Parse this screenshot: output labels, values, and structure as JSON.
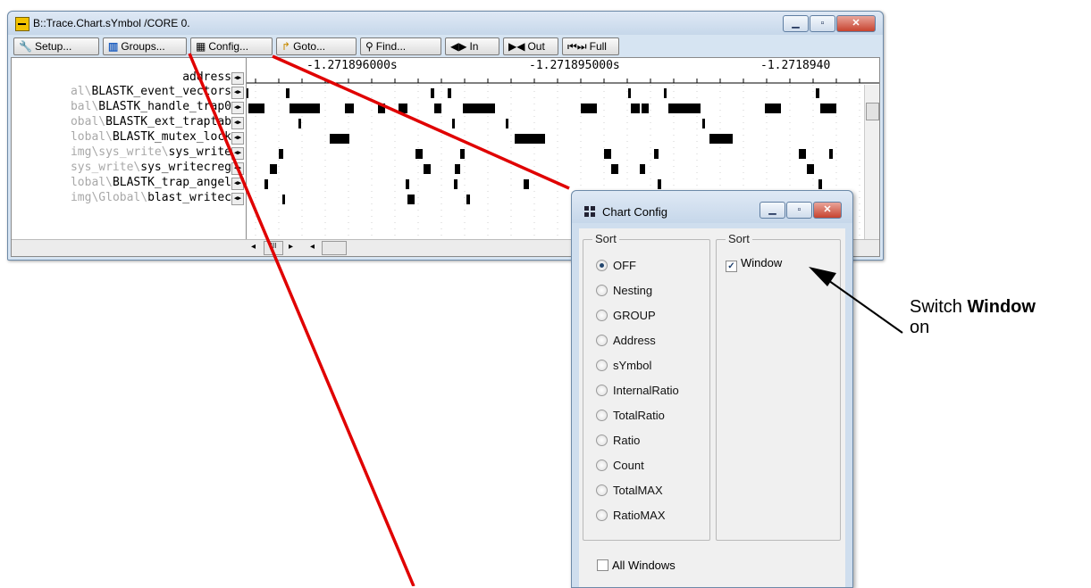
{
  "trace_window": {
    "title": "B::Trace.Chart.sYmbol /CORE 0.",
    "toolbar": {
      "setup": "Setup...",
      "groups": "Groups...",
      "config": "Config...",
      "goto": "Goto...",
      "find": "Find...",
      "in": "In",
      "out": "Out",
      "full": "Full"
    },
    "address_header": "address",
    "time_labels": [
      "-1.271896000s",
      "-1.271895000s",
      "-1.2718940"
    ],
    "rows": [
      {
        "prefix": "al\\",
        "name": "BLASTK_event_vectors"
      },
      {
        "prefix": "bal\\",
        "name": "BLASTK_handle_trap0"
      },
      {
        "prefix": "obal\\",
        "name": "BLASTK_ext_traptab"
      },
      {
        "prefix": "lobal\\",
        "name": "BLASTK_mutex_lock"
      },
      {
        "prefix": "img\\sys_write\\",
        "name": "sys_write"
      },
      {
        "prefix": "sys_write\\",
        "name": "sys_writecreg"
      },
      {
        "prefix": "lobal\\",
        "name": "BLASTK_trap_angel"
      },
      {
        "prefix": "img\\Global\\",
        "name": "blast_writec"
      }
    ]
  },
  "config_dialog": {
    "title": "Chart Config",
    "sort_group_title": "Sort",
    "sort_options": [
      "OFF",
      "Nesting",
      "GROUP",
      "Address",
      "sYmbol",
      "InternalRatio",
      "TotalRatio",
      "Ratio",
      "Count",
      "TotalMAX",
      "RatioMAX"
    ],
    "sort_selected": "OFF",
    "sort2_group_title": "Sort",
    "window_checkbox": {
      "label": "Window",
      "checked": true
    },
    "all_windows_checkbox": {
      "label": "All Windows",
      "checked": false
    }
  },
  "callout": {
    "prefix": "Switch",
    "bold": "Window",
    "suffix": "on"
  },
  "colors": {
    "annotation_line": "#e00000",
    "arrow": "#000000",
    "bar": "#000000"
  }
}
